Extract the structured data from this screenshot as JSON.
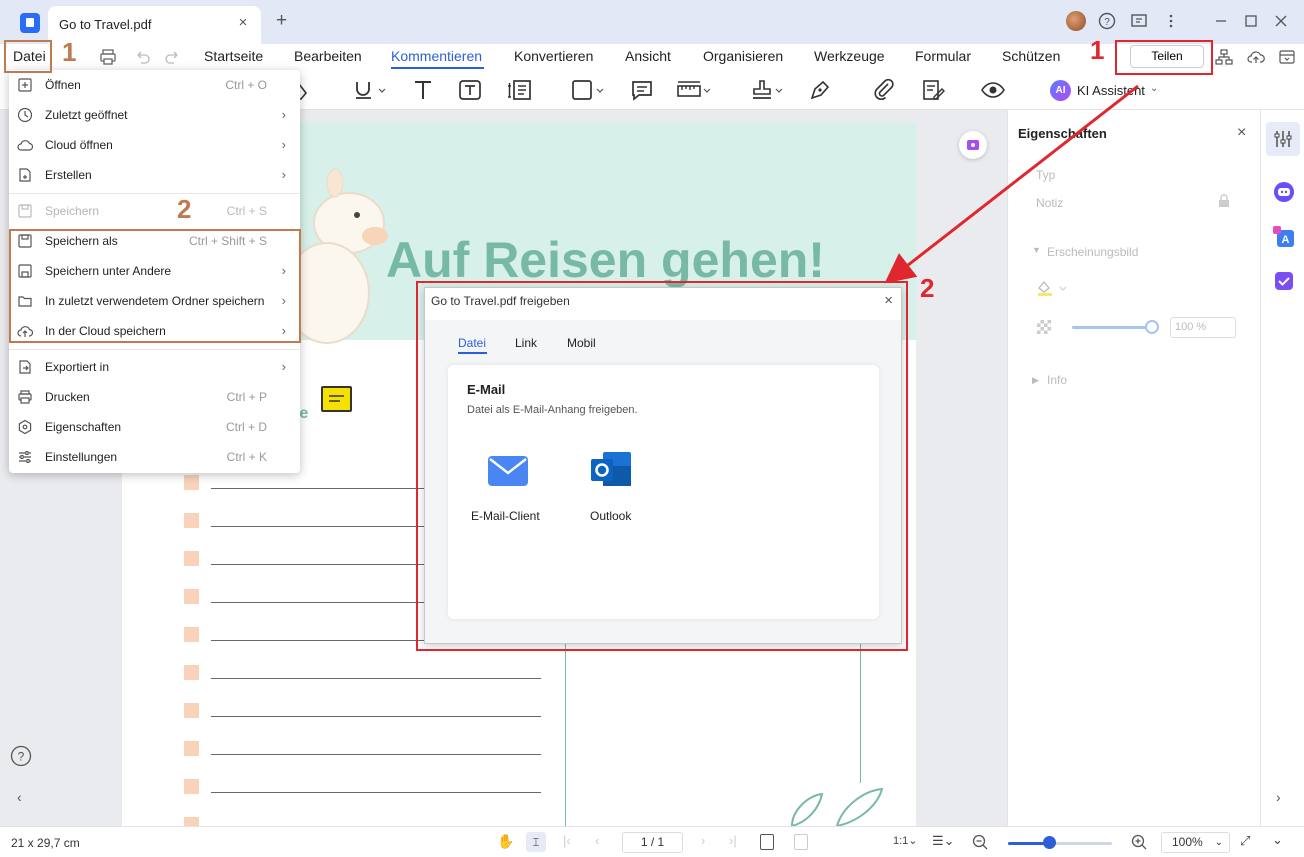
{
  "tabbar": {
    "doc_title": "Go to Travel.pdf",
    "close_glyph": "×",
    "new_tab_glyph": "+"
  },
  "menubar": {
    "datei": "Datei",
    "items": [
      "Startseite",
      "Bearbeiten",
      "Kommentieren",
      "Konvertieren",
      "Ansicht",
      "Organisieren",
      "Werkzeuge",
      "Formular",
      "Schützen"
    ],
    "active": "Kommentieren",
    "share_button": "Teilen"
  },
  "toolbar": {
    "ai_assistant": "KI Assistent",
    "ai_badge": "AI"
  },
  "document": {
    "headline": "Auf Reisen gehen!",
    "note_text": "te"
  },
  "properties": {
    "title": "Eigenschaften",
    "type_label": "Typ",
    "type_value": "Notiz",
    "appearance": "Erscheinungsbild",
    "opacity": "100 %",
    "info": "Info"
  },
  "file_menu": {
    "items": [
      {
        "label": "Öffnen",
        "shortcut": "Ctrl + O",
        "submenu": false,
        "icon": "open-plus-icon"
      },
      {
        "label": "Zuletzt geöffnet",
        "shortcut": "",
        "submenu": true,
        "icon": "clock-icon"
      },
      {
        "label": "Cloud öffnen",
        "shortcut": "",
        "submenu": true,
        "icon": "cloud-icon"
      },
      {
        "label": "Erstellen",
        "shortcut": "",
        "submenu": true,
        "icon": "create-file-icon"
      },
      {
        "label": "Speichern",
        "shortcut": "Ctrl + S",
        "submenu": false,
        "icon": "save-icon",
        "disabled": true
      },
      {
        "label": "Speichern als",
        "shortcut": "Ctrl + Shift + S",
        "submenu": false,
        "icon": "save-as-icon"
      },
      {
        "label": "Speichern unter Andere",
        "shortcut": "",
        "submenu": true,
        "icon": "save-other-icon"
      },
      {
        "label": "In zuletzt verwendetem Ordner speichern",
        "shortcut": "",
        "submenu": true,
        "icon": "folder-icon"
      },
      {
        "label": "In der Cloud speichern",
        "shortcut": "",
        "submenu": true,
        "icon": "cloud-upload-icon"
      },
      {
        "label": "Exportiert in",
        "shortcut": "",
        "submenu": true,
        "icon": "export-icon"
      },
      {
        "label": "Drucken",
        "shortcut": "Ctrl + P",
        "submenu": false,
        "icon": "print-icon"
      },
      {
        "label": "Eigenschaften",
        "shortcut": "Ctrl + D",
        "submenu": false,
        "icon": "properties-icon"
      },
      {
        "label": "Einstellungen",
        "shortcut": "Ctrl + K",
        "submenu": false,
        "icon": "settings-sliders-icon"
      }
    ]
  },
  "share_dialog": {
    "title": "Go to Travel.pdf freigeben",
    "tabs": [
      "Datei",
      "Link",
      "Mobil"
    ],
    "active_tab": "Datei",
    "section_title": "E-Mail",
    "section_desc": "Datei als E-Mail-Anhang freigeben.",
    "options": [
      "E-Mail-Client",
      "Outlook"
    ]
  },
  "statusbar": {
    "page_size": "21 x 29,7 cm",
    "page_indicator": "1 / 1",
    "zoom": "100%"
  },
  "annotations": {
    "label_1": "1",
    "label_2": "2",
    "red": "#e0262e",
    "brown": "#c07a4e"
  },
  "colors": {
    "accent": "#2b5fd9",
    "headline": "#77b9a4"
  }
}
